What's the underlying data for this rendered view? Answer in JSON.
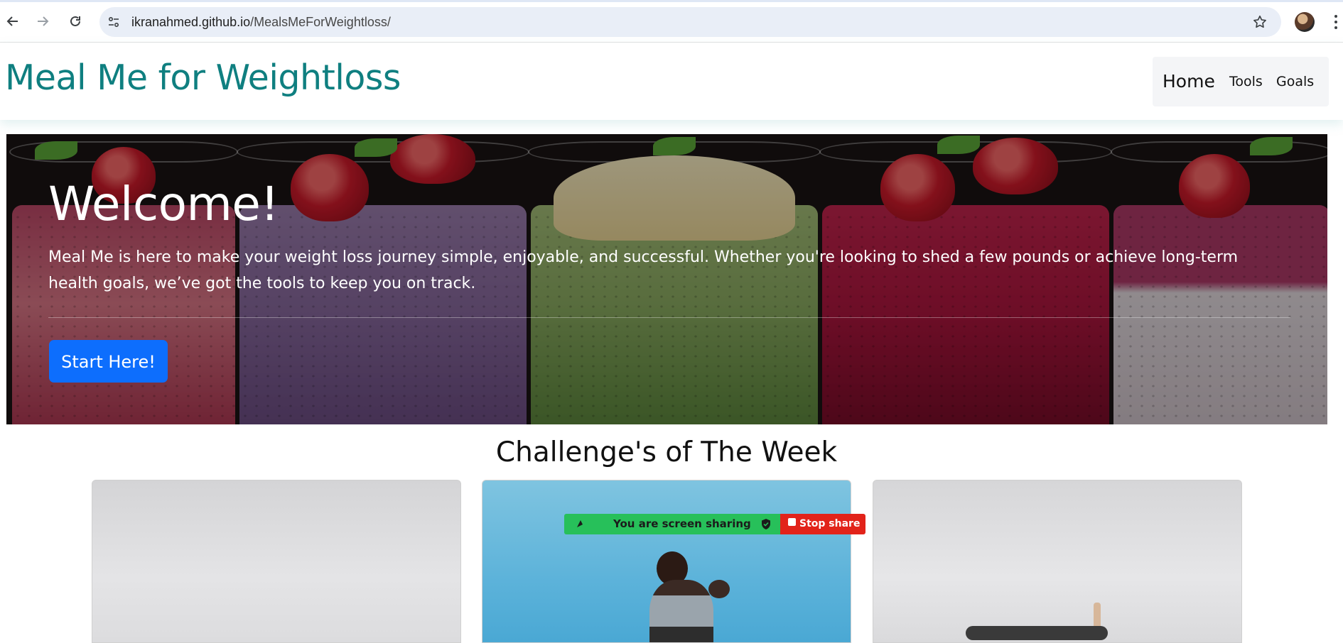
{
  "browser": {
    "url_host": "ikranahmed.github.io",
    "url_path": "/MealsMeForWeightloss/",
    "back_icon": "arrow-left-icon",
    "forward_icon": "arrow-right-icon",
    "reload_icon": "reload-icon",
    "bookmark_icon": "star-icon",
    "menu_icon": "more-vert-icon"
  },
  "navbar": {
    "brand": "Meal Me for Weightloss",
    "links": [
      {
        "label": "Home"
      },
      {
        "label": "Tools"
      },
      {
        "label": "Goals"
      }
    ],
    "brand_color": "#0f7f80"
  },
  "hero": {
    "title": "Welcome!",
    "text": "Meal Me is here to make your weight loss journey simple, enjoyable, and successful. Whether you're looking to shed a few pounds or achieve long-term health goals, we’ve got the tools to keep you on track.",
    "button_label": "Start Here!",
    "button_color": "#0d6efd"
  },
  "challenges": {
    "title": "Challenge's of The Week"
  },
  "screen_share": {
    "label": "You are screen sharing",
    "stop_label": "Stop share",
    "bar_color": "#27c05a",
    "stop_color": "#e2231a"
  }
}
